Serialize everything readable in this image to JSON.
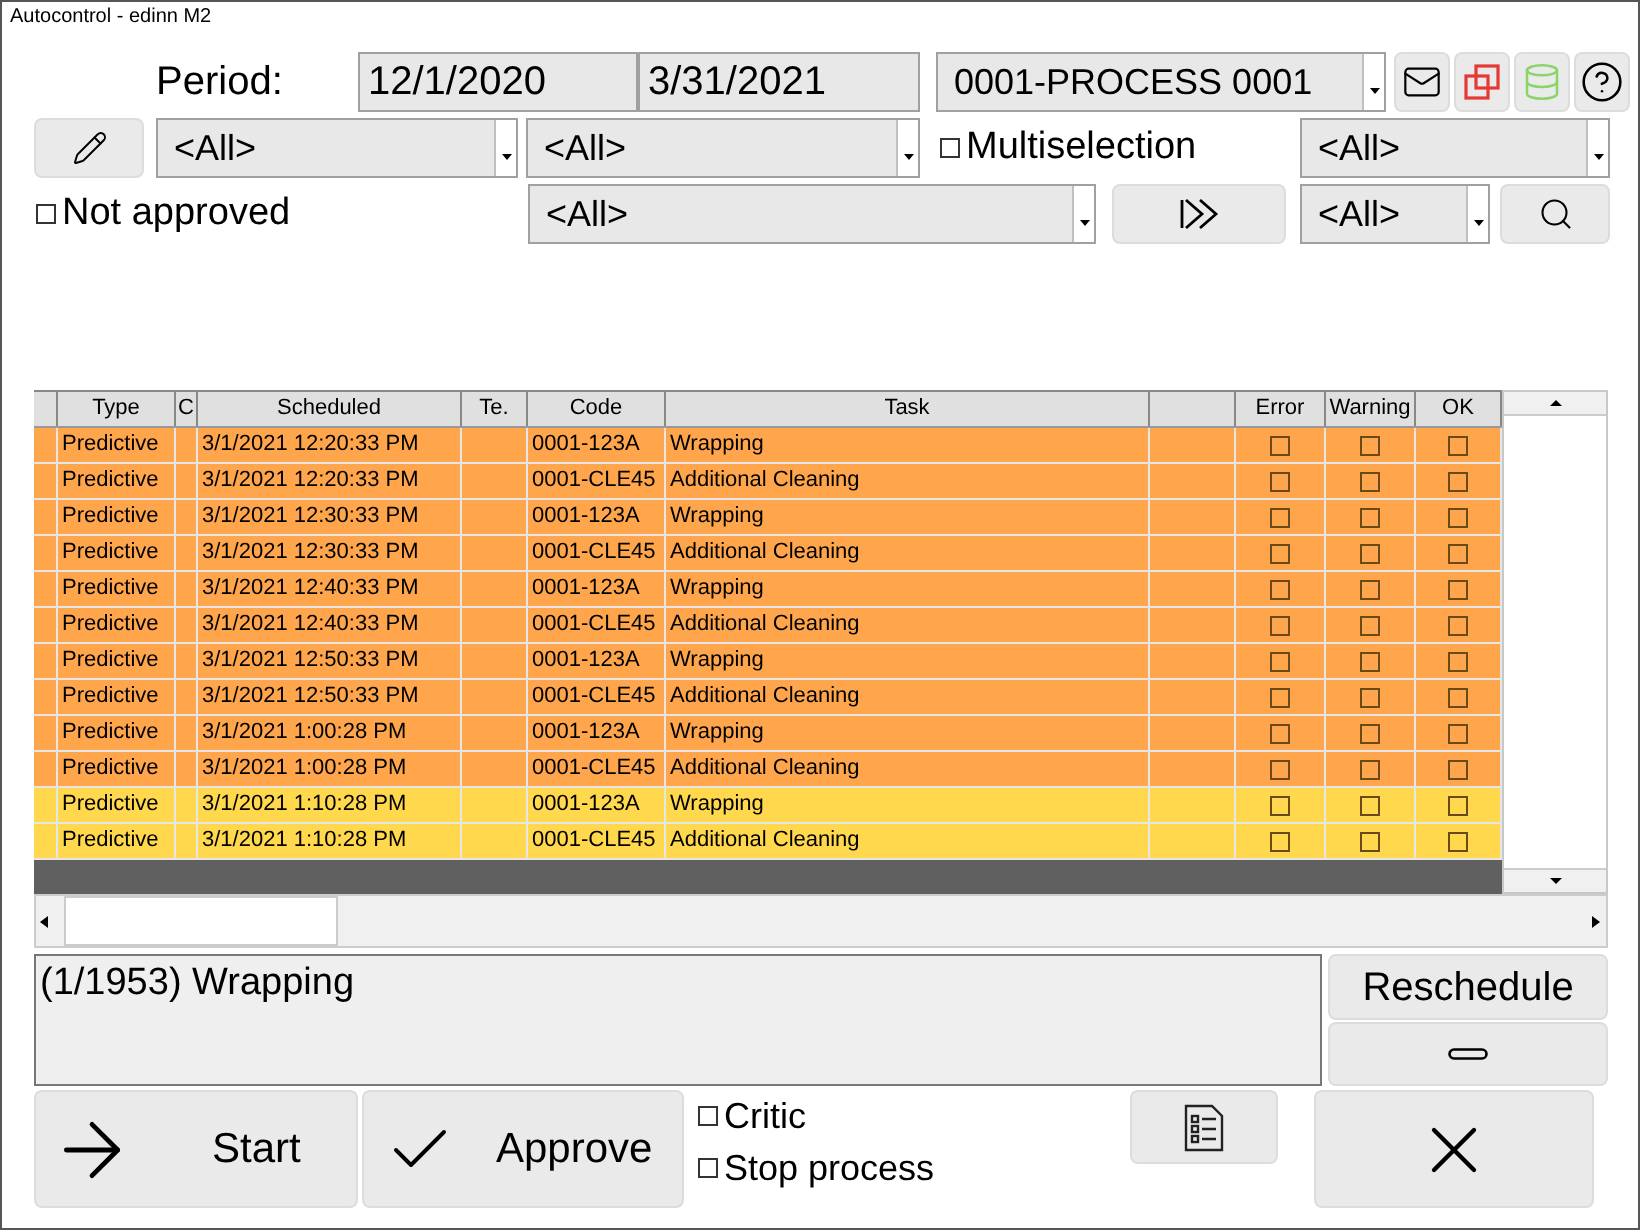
{
  "window": {
    "title": "Autocontrol - edinn M2"
  },
  "filters": {
    "period_label": "Period:",
    "date_from": "12/1/2020",
    "date_to": "3/31/2021",
    "process": "0001-PROCESS 0001",
    "combo_1": "<All>",
    "combo_2": "<All>",
    "multiselection": {
      "label": "Multiselection",
      "checked": false
    },
    "combo_3": "<All>",
    "not_approved": {
      "label": "Not approved",
      "checked": false
    },
    "combo_4": "<All>",
    "combo_5": "<All>"
  },
  "table": {
    "columns": [
      "Type",
      "C",
      "Scheduled",
      "Te.",
      "Code",
      "Task",
      "Error",
      "Warning",
      "OK"
    ],
    "rows": [
      {
        "type": "Predictive",
        "scheduled": "3/1/2021 12:20:33 PM",
        "code": "0001-123A",
        "task": "Wrapping",
        "color": "#ffa64d",
        "error": false,
        "warning": false,
        "ok": false
      },
      {
        "type": "Predictive",
        "scheduled": "3/1/2021 12:20:33 PM",
        "code": "0001-CLE45",
        "task": "Additional Cleaning",
        "color": "#ffa64d",
        "error": false,
        "warning": false,
        "ok": false
      },
      {
        "type": "Predictive",
        "scheduled": "3/1/2021 12:30:33 PM",
        "code": "0001-123A",
        "task": "Wrapping",
        "color": "#ffa64d",
        "error": false,
        "warning": false,
        "ok": false
      },
      {
        "type": "Predictive",
        "scheduled": "3/1/2021 12:30:33 PM",
        "code": "0001-CLE45",
        "task": "Additional Cleaning",
        "color": "#ffa64d",
        "error": false,
        "warning": false,
        "ok": false
      },
      {
        "type": "Predictive",
        "scheduled": "3/1/2021 12:40:33 PM",
        "code": "0001-123A",
        "task": "Wrapping",
        "color": "#ffa64d",
        "error": false,
        "warning": false,
        "ok": false
      },
      {
        "type": "Predictive",
        "scheduled": "3/1/2021 12:40:33 PM",
        "code": "0001-CLE45",
        "task": "Additional Cleaning",
        "color": "#ffa64d",
        "error": false,
        "warning": false,
        "ok": false
      },
      {
        "type": "Predictive",
        "scheduled": "3/1/2021 12:50:33 PM",
        "code": "0001-123A",
        "task": "Wrapping",
        "color": "#ffa64d",
        "error": false,
        "warning": false,
        "ok": false
      },
      {
        "type": "Predictive",
        "scheduled": "3/1/2021 12:50:33 PM",
        "code": "0001-CLE45",
        "task": "Additional Cleaning",
        "color": "#ffa64d",
        "error": false,
        "warning": false,
        "ok": false
      },
      {
        "type": "Predictive",
        "scheduled": "3/1/2021 1:00:28 PM",
        "code": "0001-123A",
        "task": "Wrapping",
        "color": "#ffa64d",
        "error": false,
        "warning": false,
        "ok": false
      },
      {
        "type": "Predictive",
        "scheduled": "3/1/2021 1:00:28 PM",
        "code": "0001-CLE45",
        "task": "Additional Cleaning",
        "color": "#ffa64d",
        "error": false,
        "warning": false,
        "ok": false
      },
      {
        "type": "Predictive",
        "scheduled": "3/1/2021 1:10:28 PM",
        "code": "0001-123A",
        "task": "Wrapping",
        "color": "#ffd84d",
        "error": false,
        "warning": false,
        "ok": false
      },
      {
        "type": "Predictive",
        "scheduled": "3/1/2021 1:10:28 PM",
        "code": "0001-CLE45",
        "task": "Additional Cleaning",
        "color": "#ffd84d",
        "error": false,
        "warning": false,
        "ok": false
      }
    ]
  },
  "message": "(1/1953) Wrapping",
  "buttons": {
    "reschedule": "Reschedule",
    "start": "Start",
    "approve": "Approve"
  },
  "options": [
    {
      "label": "Critic",
      "checked": false
    },
    {
      "label": "Stop process",
      "checked": false
    }
  ]
}
